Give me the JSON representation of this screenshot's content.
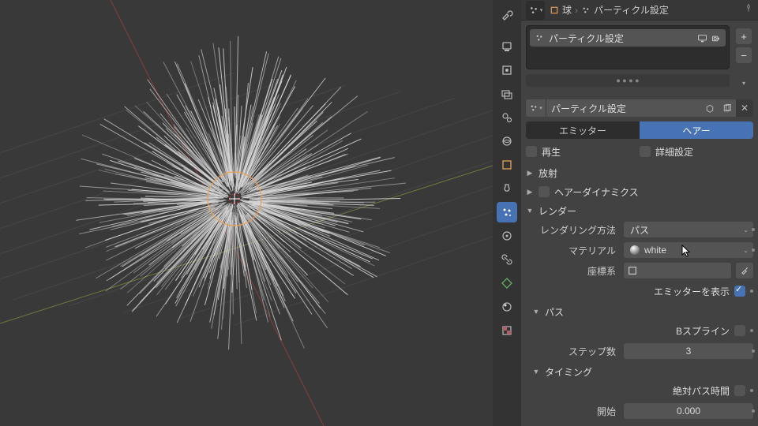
{
  "breadcrumb": {
    "obj": "球",
    "ps": "パーティクル設定"
  },
  "list": {
    "item_name": "パーティクル設定"
  },
  "id_field": {
    "value": "パーティクル設定"
  },
  "tabs": {
    "emitter": "エミッター",
    "hair": "ヘアー"
  },
  "checks": {
    "regrow": "再生",
    "advanced": "詳細設定"
  },
  "sections": {
    "emission": "放射",
    "hair_dynamics": "ヘアーダイナミクス",
    "render": "レンダー",
    "path": "パス",
    "timing": "タイミング"
  },
  "render": {
    "render_as_label": "レンダリング方法",
    "render_as_value": "パス",
    "material_label": "マテリアル",
    "material_value": "white",
    "coord_label": "座標系",
    "coord_value": "",
    "show_emitter_label": "エミッターを表示"
  },
  "path": {
    "bspline_label": "Bスプライン",
    "steps_label": "ステップ数",
    "steps_value": "3"
  },
  "timing": {
    "abs_label": "絶対パス時間",
    "start_label": "開始",
    "start_value": "0.000"
  }
}
